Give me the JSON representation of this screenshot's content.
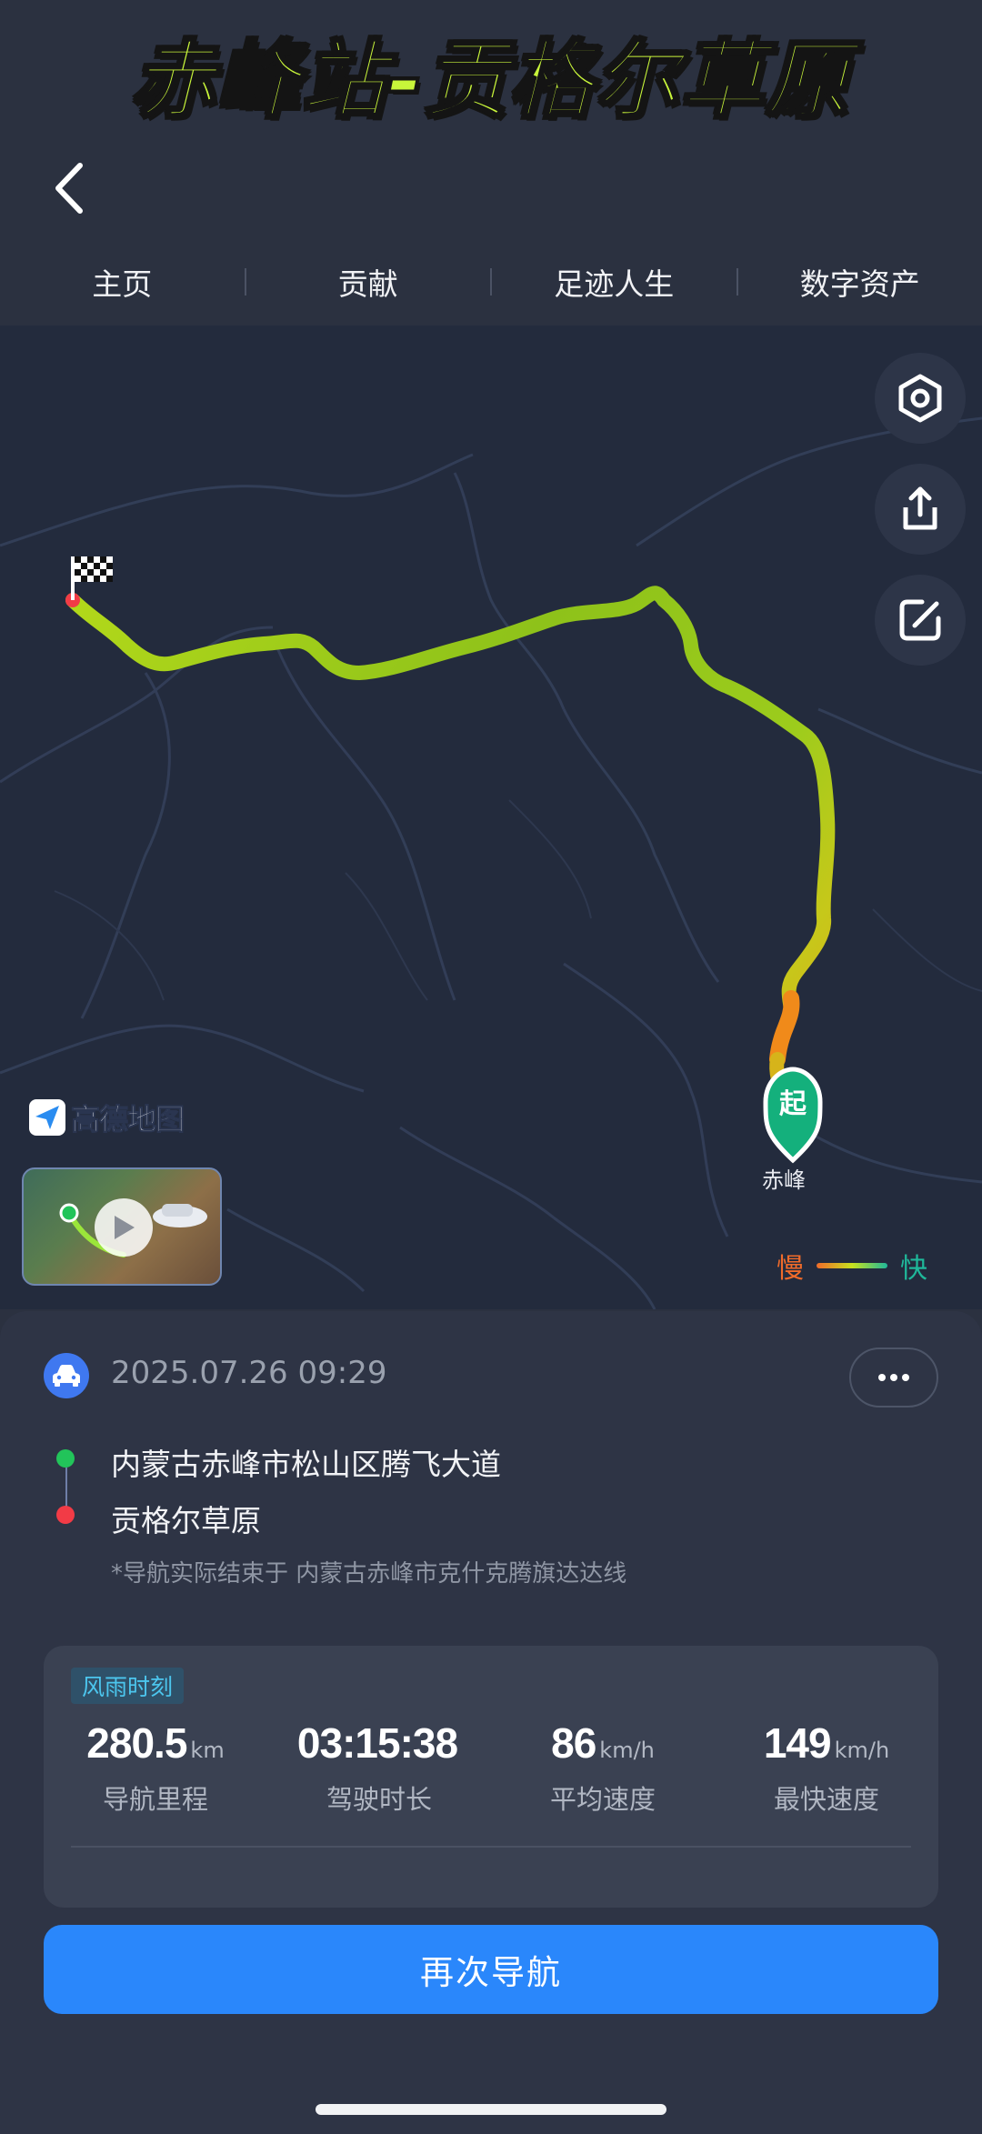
{
  "overlay_title": "赤峰站-贡格尔草原",
  "tabs": [
    "主页",
    "贡献",
    "足迹人生",
    "数字资产"
  ],
  "map": {
    "provider_logo_text": "高德地图",
    "start_marker": "起",
    "start_label": "赤峰",
    "legend": {
      "slow": "慢",
      "fast": "快"
    }
  },
  "icons": {
    "back": "chevron-left-icon",
    "settings": "hexagon-settings-icon",
    "share": "share-icon",
    "edit": "edit-icon",
    "car": "car-icon",
    "more": "more-icon",
    "play": "play-icon",
    "finish": "checkered-flag-icon"
  },
  "colors": {
    "background": "#2b3140",
    "map_background": "#232b3d",
    "route_yellow_green": "#a8d41c",
    "route_orange": "#f08a1a",
    "start_pin": "#14b07c",
    "start_dot": "#22c45a",
    "end_dot": "#f23b46",
    "primary_button": "#2a87fb",
    "badge_text": "#4cc6ee"
  },
  "trip": {
    "datetime": "2025.07.26 09:29",
    "start": "内蒙古赤峰市松山区腾飞大道",
    "end": "贡格尔草原",
    "note": "*导航实际结束于 内蒙古赤峰市克什克腾旗达达线",
    "badge": "风雨时刻",
    "stats": [
      {
        "value": "280.5",
        "unit": "km",
        "label": "导航里程"
      },
      {
        "value": "03:15:38",
        "unit": "",
        "label": "驾驶时长"
      },
      {
        "value": "86",
        "unit": "km/h",
        "label": "平均速度"
      },
      {
        "value": "149",
        "unit": "km/h",
        "label": "最快速度"
      }
    ],
    "nav_again": "再次导航"
  }
}
